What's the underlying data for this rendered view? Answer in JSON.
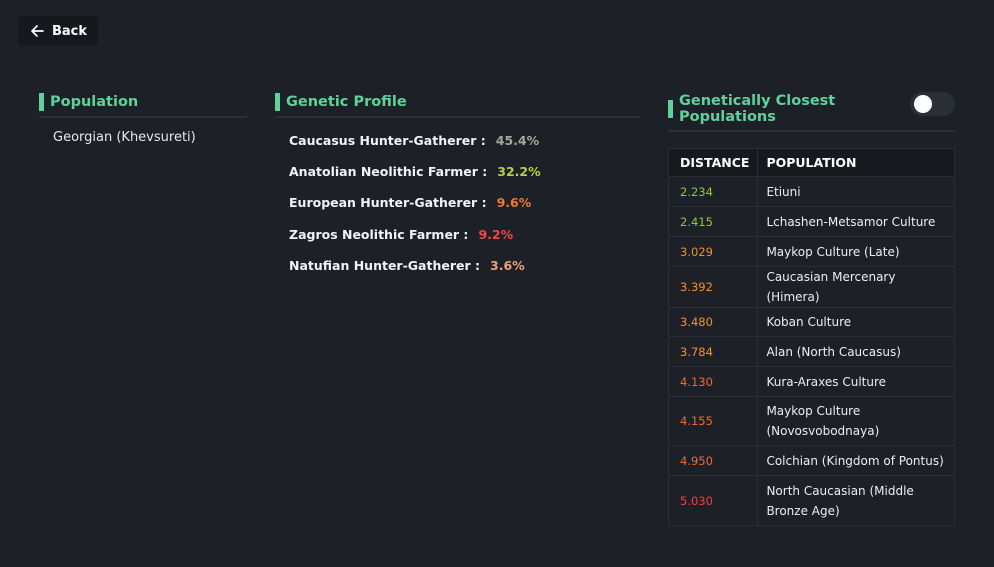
{
  "back_label": "Back",
  "population": {
    "title": "Population",
    "name": "Georgian (Khevsureti)"
  },
  "genetic_profile": {
    "title": "Genetic Profile",
    "items": [
      {
        "label": "Caucasus Hunter-Gatherer :",
        "value": "45.4%",
        "color": "#a8a69a"
      },
      {
        "label": "Anatolian Neolithic Farmer :",
        "value": "32.2%",
        "color": "#b8cf4a"
      },
      {
        "label": "European Hunter-Gatherer :",
        "value": "9.6%",
        "color": "#f0792f"
      },
      {
        "label": "Zagros Neolithic Farmer :",
        "value": "9.2%",
        "color": "#ef4a45"
      },
      {
        "label": "Natufian Hunter-Gatherer :",
        "value": "3.6%",
        "color": "#e9a37c"
      }
    ]
  },
  "closest": {
    "title": "Genetically Closest Populations",
    "toggle_on": false,
    "headers": {
      "distance": "DISTANCE",
      "population": "POPULATION"
    },
    "rows": [
      {
        "distance": "2.234",
        "population": "Etiuni",
        "color": "#8fc93a",
        "height": 30
      },
      {
        "distance": "2.415",
        "population": "Lchashen-Metsamor Culture",
        "color": "#8fc93a",
        "height": 30
      },
      {
        "distance": "3.029",
        "population": "Maykop Culture (Late)",
        "color": "#f0902e",
        "height": 30
      },
      {
        "distance": "3.392",
        "population": "Caucasian Mercenary (Himera)",
        "color": "#f0902e",
        "height": 30
      },
      {
        "distance": "3.480",
        "population": "Koban Culture",
        "color": "#f0902e",
        "height": 29
      },
      {
        "distance": "3.784",
        "population": "Alan (North Caucasus)",
        "color": "#f0902e",
        "height": 30
      },
      {
        "distance": "4.130",
        "population": "Kura-Araxes Culture",
        "color": "#f06a2e",
        "height": 30
      },
      {
        "distance": "4.155",
        "population": "Maykop Culture (Novosvobodnaya)",
        "color": "#f06a2e",
        "height": 49
      },
      {
        "distance": "4.950",
        "population": "Colchian (Kingdom of Pontus)",
        "color": "#f06a2e",
        "height": 30
      },
      {
        "distance": "5.030",
        "population": "North Caucasian (Middle Bronze Age)",
        "color": "#ef4040",
        "height": 50
      }
    ]
  }
}
